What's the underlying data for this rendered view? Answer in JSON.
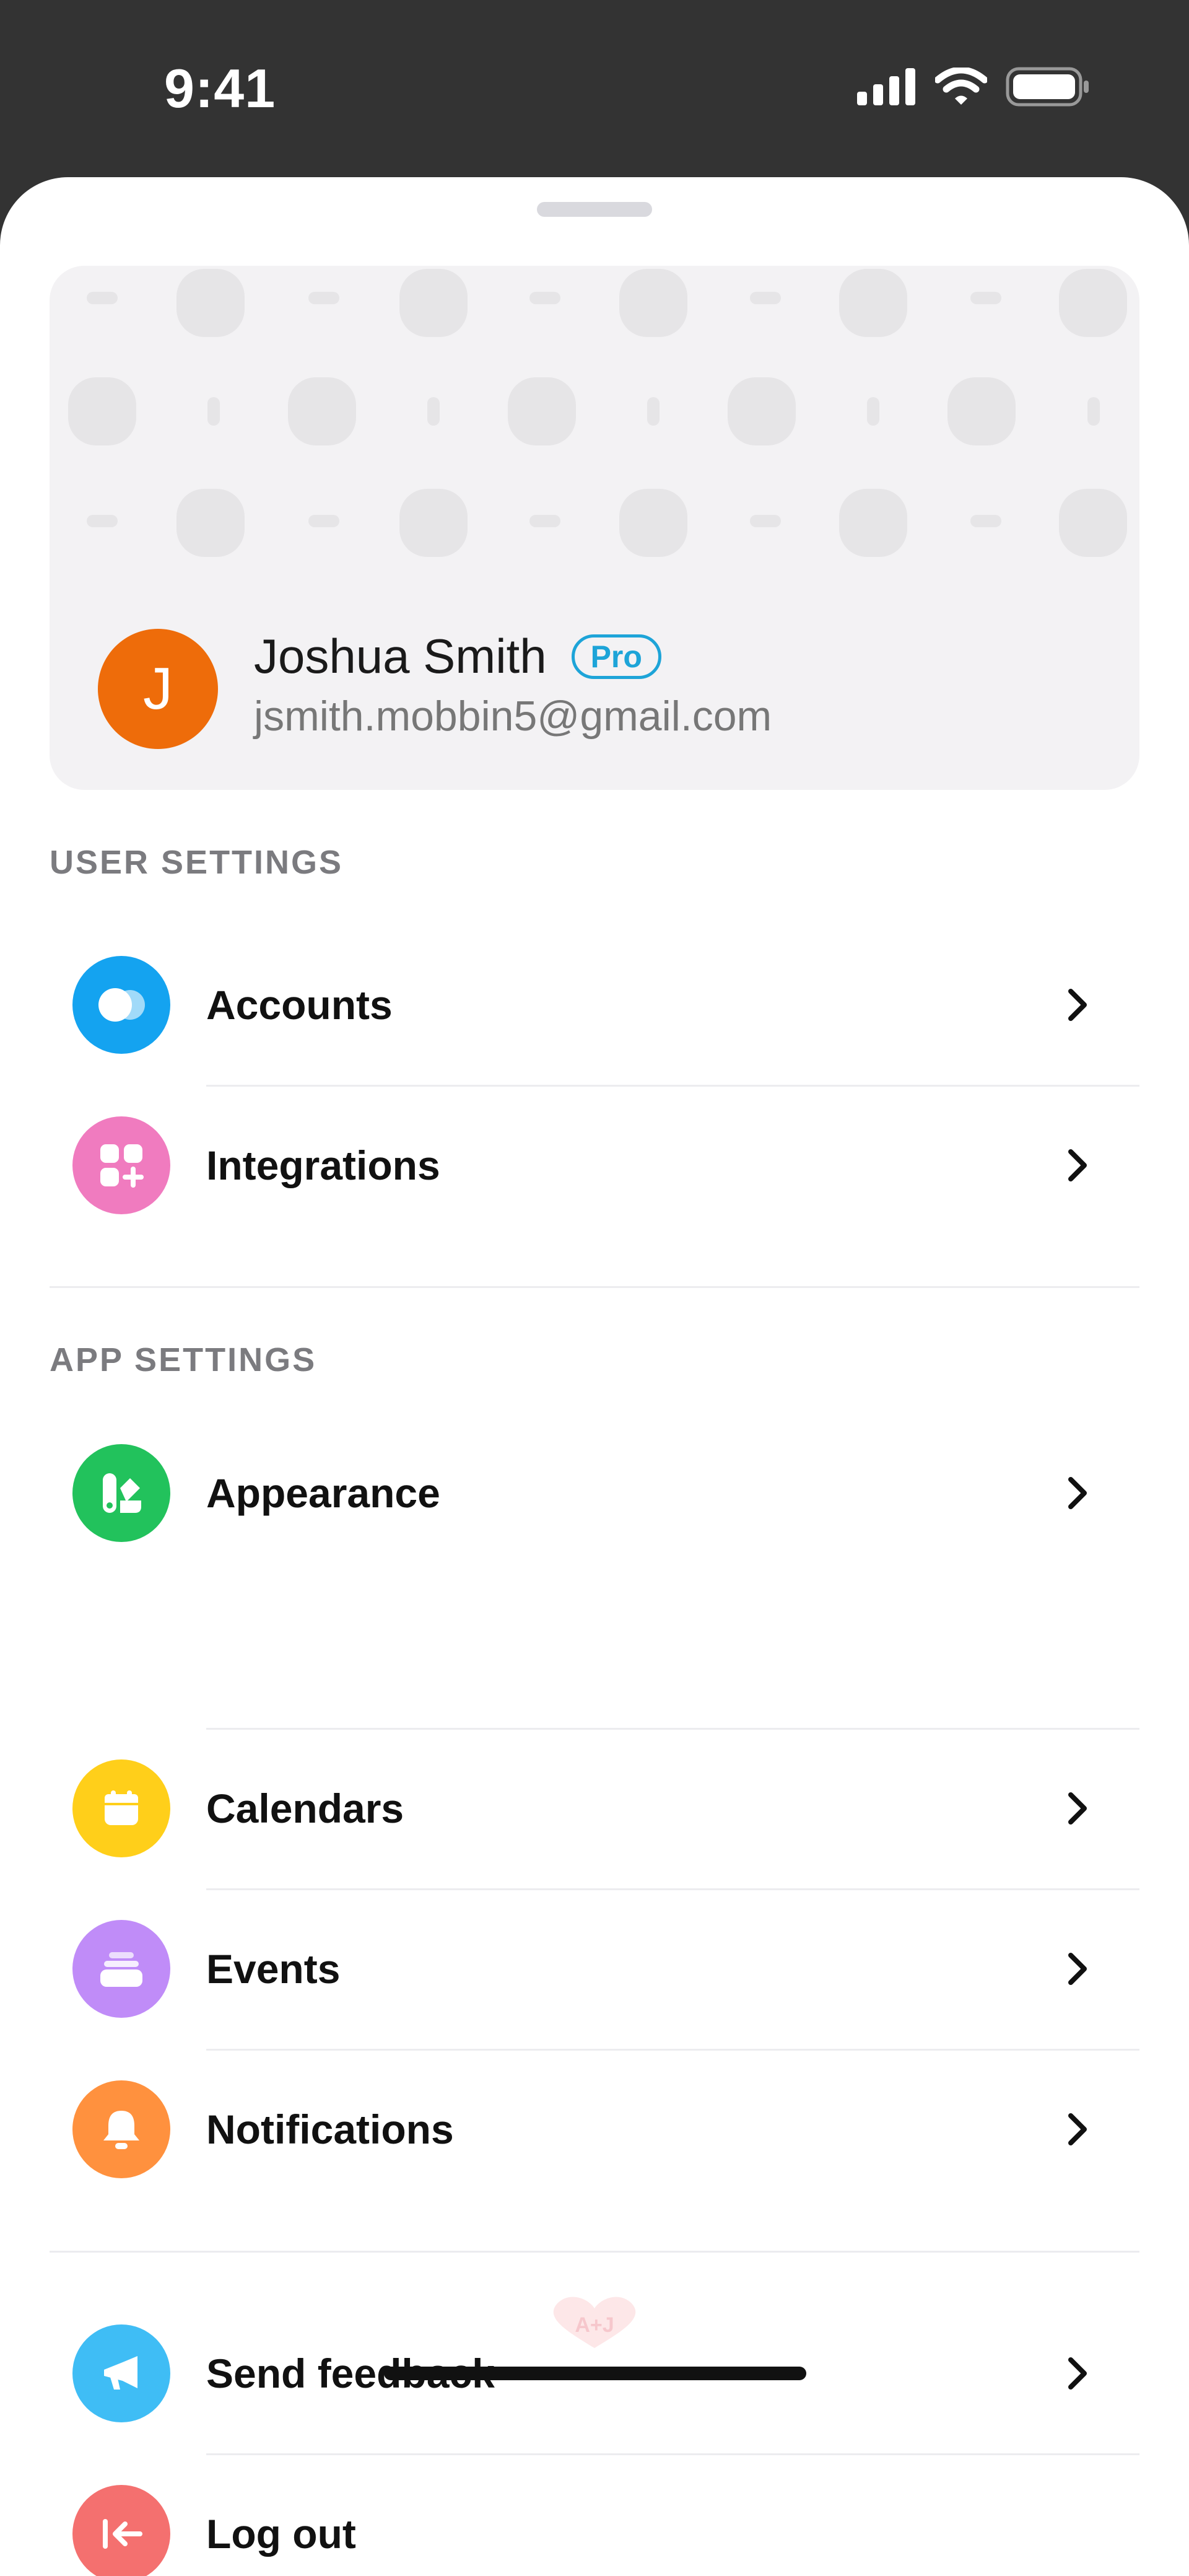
{
  "status": {
    "time": "9:41"
  },
  "profile": {
    "initial": "J",
    "name": "Joshua Smith",
    "badge": "Pro",
    "email": "jsmith.mobbin5@gmail.com",
    "avatar_color": "#ee6c0a"
  },
  "sections": {
    "user_settings": {
      "title": "USER SETTINGS",
      "items": [
        {
          "label": "Accounts",
          "icon": "accounts-icon",
          "color": "#14a3f0"
        },
        {
          "label": "Integrations",
          "icon": "integrations-icon",
          "color": "#f07bbf"
        }
      ]
    },
    "app_settings": {
      "title": "APP SETTINGS",
      "items": [
        {
          "label": "Appearance",
          "icon": "appearance-icon",
          "color": "#22c25c"
        },
        {
          "label": "Calendars",
          "icon": "calendar-icon",
          "color": "#ffcf1a"
        },
        {
          "label": "Events",
          "icon": "events-icon",
          "color": "#c08cf8"
        },
        {
          "label": "Notifications",
          "icon": "bell-icon",
          "color": "#ff913e"
        }
      ]
    },
    "other": {
      "items": [
        {
          "label": "Send feedback",
          "icon": "megaphone-icon",
          "color": "#3fbdf5"
        },
        {
          "label": "Log out",
          "icon": "logout-icon",
          "color": "#f4706f"
        }
      ]
    }
  },
  "footer": {
    "logo": "A+J"
  }
}
